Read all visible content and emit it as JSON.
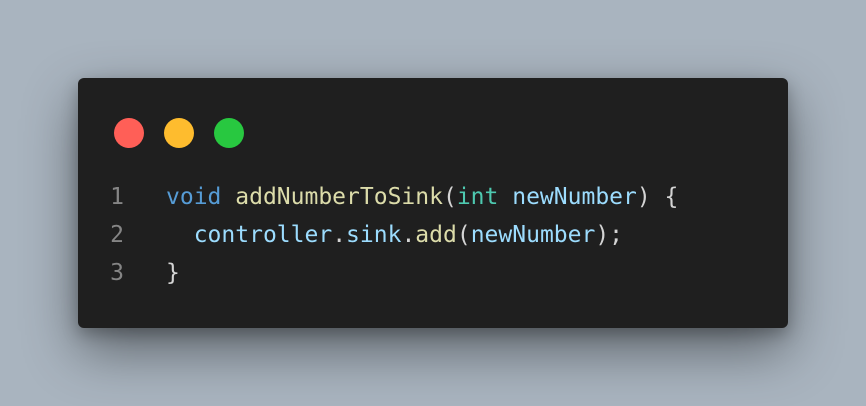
{
  "window_controls": {
    "close_color": "#ff5f57",
    "minimize_color": "#febc2e",
    "maximize_color": "#28c840"
  },
  "code": {
    "lines": [
      {
        "number": "1",
        "tokens": [
          {
            "text": "void",
            "kind": "keyword"
          },
          {
            "text": " ",
            "kind": "plain"
          },
          {
            "text": "addNumberToSink",
            "kind": "function"
          },
          {
            "text": "(",
            "kind": "plain"
          },
          {
            "text": "int",
            "kind": "type"
          },
          {
            "text": " ",
            "kind": "plain"
          },
          {
            "text": "newNumber",
            "kind": "variable"
          },
          {
            "text": ") {",
            "kind": "plain"
          }
        ]
      },
      {
        "number": "2",
        "tokens": [
          {
            "text": "  ",
            "kind": "plain"
          },
          {
            "text": "controller",
            "kind": "variable"
          },
          {
            "text": ".",
            "kind": "plain"
          },
          {
            "text": "sink",
            "kind": "variable"
          },
          {
            "text": ".",
            "kind": "plain"
          },
          {
            "text": "add",
            "kind": "function"
          },
          {
            "text": "(",
            "kind": "plain"
          },
          {
            "text": "newNumber",
            "kind": "variable"
          },
          {
            "text": ");",
            "kind": "plain"
          }
        ]
      },
      {
        "number": "3",
        "tokens": [
          {
            "text": "}",
            "kind": "plain"
          }
        ]
      }
    ]
  },
  "colors": {
    "keyword": "#569cd6",
    "function": "#dcdcaa",
    "type": "#4ec9b0",
    "variable": "#9cdcfe",
    "plain": "#d4d4d4",
    "line_number": "#858585",
    "editor_background": "#1f1f1f",
    "page_background": "#a9b4bf"
  }
}
